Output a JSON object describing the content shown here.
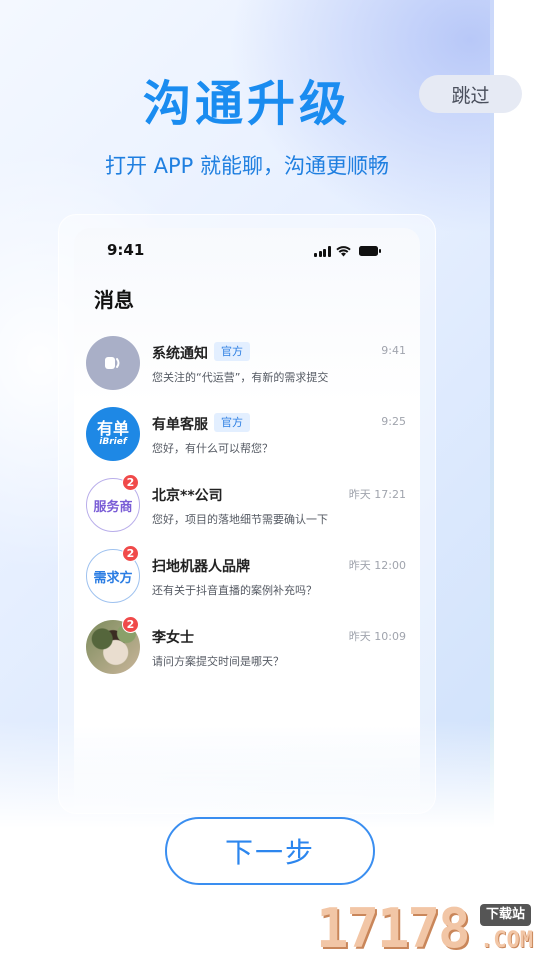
{
  "header": {
    "title": "沟通升级",
    "subtitle": "打开 APP 就能聊，沟通更顺畅",
    "skip_label": "跳过"
  },
  "phone": {
    "status_time": "9:41",
    "page_title": "消息",
    "messages": [
      {
        "name": "系统通知",
        "tag": "官方",
        "time": "9:41",
        "preview": "您关注的“代运营”，有新的需求提交",
        "avatar": "speaker-icon",
        "badge": ""
      },
      {
        "name": "有单客服",
        "tag": "官方",
        "time": "9:25",
        "preview": "您好，有什么可以帮您？",
        "avatar": "brand-logo",
        "avatar_text": "有单",
        "avatar_sub": "iBrief",
        "badge": ""
      },
      {
        "name": "北京**公司",
        "tag": "",
        "time": "昨天 17:21",
        "preview": "您好，项目的落地细节需要确认一下",
        "avatar": "text",
        "avatar_text": "服务商",
        "badge": "2"
      },
      {
        "name": "扫地机器人品牌",
        "tag": "",
        "time": "昨天 12:00",
        "preview": "还有关于抖音直播的案例补充吗？",
        "avatar": "text",
        "avatar_text": "需求方",
        "badge": "2"
      },
      {
        "name": "李女士",
        "tag": "",
        "time": "昨天 10:09",
        "preview": "请问方案提交时间是哪天？",
        "avatar": "photo",
        "badge": "2"
      }
    ]
  },
  "footer": {
    "next_label": "下一步"
  },
  "watermark": {
    "number": "17178",
    "tag": "下载站",
    "suffix": ".COM"
  },
  "colors": {
    "accent": "#1a8cf0",
    "badge": "#f04a4a",
    "tag_bg": "#e3efff"
  }
}
